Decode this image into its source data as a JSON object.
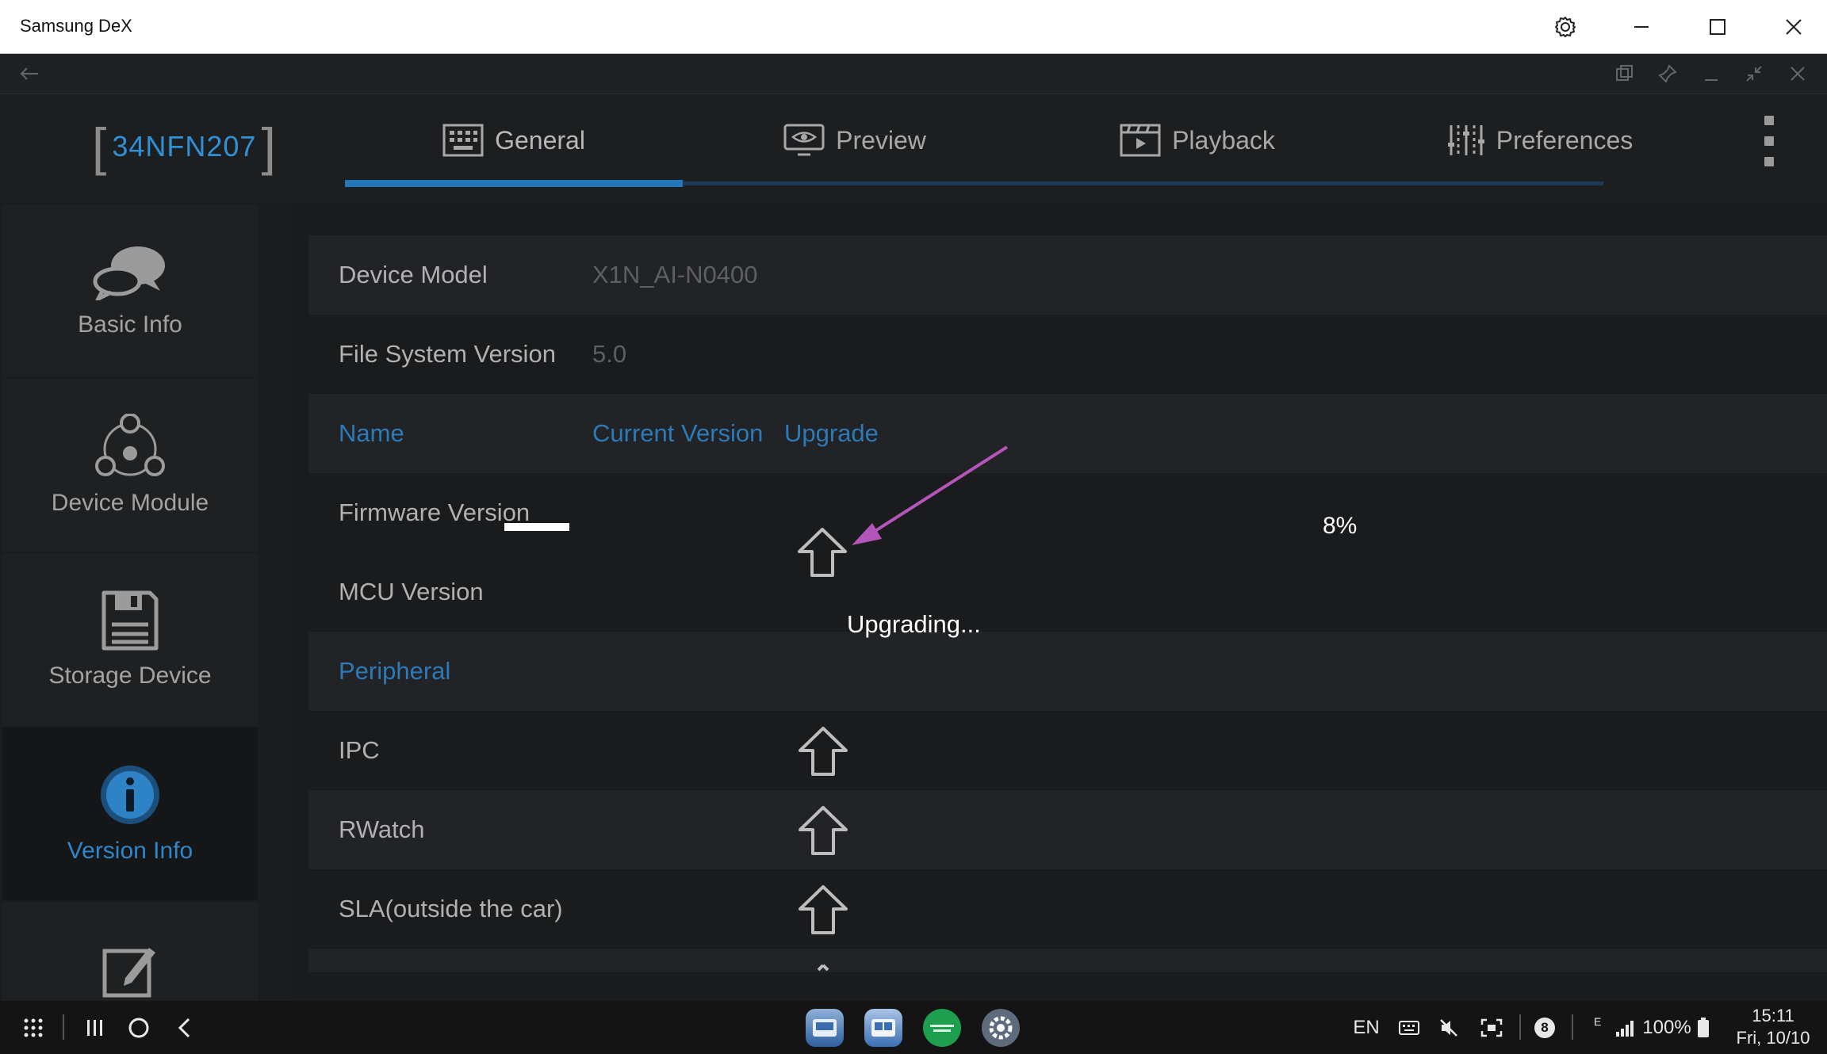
{
  "window": {
    "title": "Samsung DeX"
  },
  "header": {
    "device_id": "34NFN207",
    "tabs": [
      {
        "label": "General",
        "icon": "keyboard-icon",
        "active": true
      },
      {
        "label": "Preview",
        "icon": "monitor-eye-icon"
      },
      {
        "label": "Playback",
        "icon": "film-play-icon"
      },
      {
        "label": "Preferences",
        "icon": "sliders-icon"
      }
    ]
  },
  "sidebar": {
    "items": [
      {
        "label": "Basic Info",
        "icon": "chat-bubbles-icon"
      },
      {
        "label": "Device Module",
        "icon": "modules-icon"
      },
      {
        "label": "Storage Device",
        "icon": "floppy-disk-icon"
      },
      {
        "label": "Version Info",
        "icon": "info-icon",
        "active": true
      },
      {
        "label": "",
        "icon": "edit-icon"
      }
    ]
  },
  "main": {
    "device_model": {
      "label": "Device Model",
      "value": "X1N_AI-N0400"
    },
    "fs_version": {
      "label": "File System Version",
      "value": "5.0"
    },
    "table_header": {
      "name": "Name",
      "current": "Current Version",
      "upgrade": "Upgrade"
    },
    "firmware": {
      "label": "Firmware Version"
    },
    "mcu": {
      "label": "MCU Version"
    },
    "peripheral_header": "Peripheral",
    "peripherals": [
      {
        "label": "IPC"
      },
      {
        "label": "RWatch"
      },
      {
        "label": "SLA(outside the car)"
      }
    ]
  },
  "upgrade": {
    "percent": "8%",
    "status": "Upgrading..."
  },
  "taskbar": {
    "lang": "EN",
    "notif_count": "8",
    "network": "E",
    "battery": "100%",
    "time": "15:11",
    "date": "Fri, 10/10"
  },
  "colors": {
    "accent": "#2f86c8",
    "annotation_arrow": "#b455b9"
  }
}
